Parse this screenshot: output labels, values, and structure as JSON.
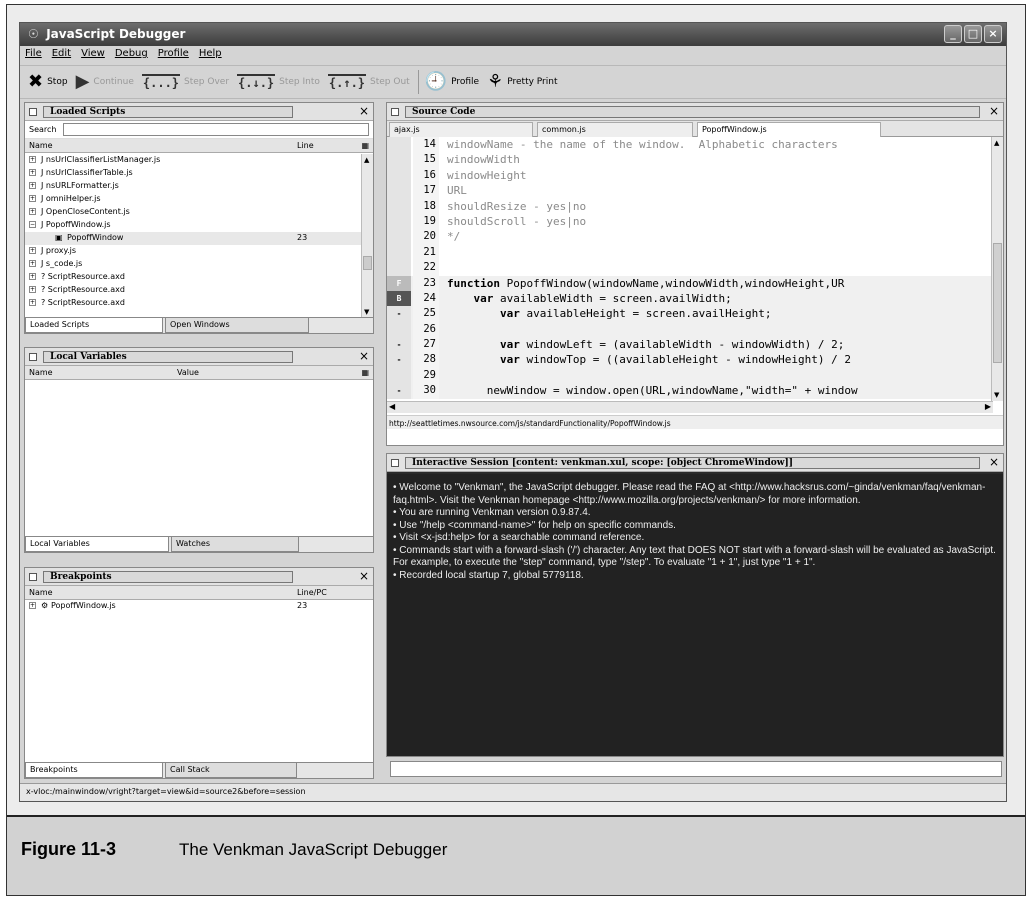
{
  "window": {
    "title": "JavaScript Debugger",
    "controls": [
      "_",
      "□",
      "×"
    ]
  },
  "menu": [
    "File",
    "Edit",
    "View",
    "Debug",
    "Profile",
    "Help"
  ],
  "toolbar": [
    {
      "label": "Stop",
      "icon": "stop-icon",
      "enabled": true
    },
    {
      "label": "Continue",
      "icon": "continue-icon",
      "enabled": false
    },
    {
      "label": "Step Over",
      "icon": "step-over-icon",
      "enabled": false
    },
    {
      "label": "Step Into",
      "icon": "step-into-icon",
      "enabled": false
    },
    {
      "label": "Step Out",
      "icon": "step-out-icon",
      "enabled": false
    },
    {
      "label": "Profile",
      "icon": "profile-icon",
      "enabled": true
    },
    {
      "label": "Pretty Print",
      "icon": "pretty-print-icon",
      "enabled": true
    }
  ],
  "loaded_scripts": {
    "title": "Loaded Scripts",
    "search_label": "Search",
    "columns": [
      "Name",
      "Line"
    ],
    "rows": [
      {
        "toggle": "+",
        "name": "J nsUrlClassifierListManager.js",
        "line": ""
      },
      {
        "toggle": "+",
        "name": "J nsUrlClassifierTable.js",
        "line": ""
      },
      {
        "toggle": "+",
        "name": "J nsURLFormatter.js",
        "line": ""
      },
      {
        "toggle": "+",
        "name": "J omniHelper.js",
        "line": ""
      },
      {
        "toggle": "+",
        "name": "J OpenCloseContent.js",
        "line": ""
      },
      {
        "toggle": "−",
        "name": "J PopoffWindow.js",
        "line": ""
      },
      {
        "toggle": "",
        "name": "PopoffWindow",
        "line": "23",
        "child": true
      },
      {
        "toggle": "+",
        "name": "J proxy.js",
        "line": ""
      },
      {
        "toggle": "+",
        "name": "J s_code.js",
        "line": ""
      },
      {
        "toggle": "+",
        "name": "? ScriptResource.axd",
        "line": ""
      },
      {
        "toggle": "+",
        "name": "? ScriptResource.axd",
        "line": ""
      },
      {
        "toggle": "+",
        "name": "? ScriptResource.axd",
        "line": ""
      }
    ],
    "tabs": [
      "Loaded Scripts",
      "Open Windows"
    ]
  },
  "local_variables": {
    "title": "Local Variables",
    "columns": [
      "Name",
      "Value"
    ],
    "tabs": [
      "Local Variables",
      "Watches"
    ]
  },
  "breakpoints": {
    "title": "Breakpoints",
    "columns": [
      "Name",
      "Line/PC"
    ],
    "rows": [
      {
        "name": "PopoffWindow.js",
        "line": "23"
      }
    ],
    "tabs": [
      "Breakpoints",
      "Call Stack"
    ]
  },
  "source": {
    "title": "Source Code",
    "tabs": [
      "ajax.js",
      "common.js",
      "PopoffWindow.js"
    ],
    "lines": [
      {
        "n": "14",
        "gutter": "",
        "text": "windowName - the name of the window.  Alphabetic characters",
        "comment": true
      },
      {
        "n": "15",
        "gutter": "",
        "text": "windowWidth",
        "comment": true
      },
      {
        "n": "16",
        "gutter": "",
        "text": "windowHeight",
        "comment": true
      },
      {
        "n": "17",
        "gutter": "",
        "text": "URL",
        "comment": true
      },
      {
        "n": "18",
        "gutter": "",
        "text": "shouldResize - yes|no",
        "comment": true
      },
      {
        "n": "19",
        "gutter": "",
        "text": "shouldScroll - yes|no",
        "comment": true
      },
      {
        "n": "20",
        "gutter": "",
        "text": "*/",
        "comment": true
      },
      {
        "n": "21",
        "gutter": "",
        "text": "",
        "comment": false
      },
      {
        "n": "22",
        "gutter": "",
        "text": "",
        "comment": false
      },
      {
        "n": "23",
        "gutter": "F",
        "text": "function PopoffWindow(windowName,windowWidth,windowHeight,UR",
        "comment": false,
        "kw": "function"
      },
      {
        "n": "24",
        "gutter": "B",
        "text": "    var availableWidth = screen.availWidth;",
        "comment": false,
        "kw": "var"
      },
      {
        "n": "25",
        "gutter": "-",
        "text": "        var availableHeight = screen.availHeight;",
        "comment": false,
        "kw": "var"
      },
      {
        "n": "26",
        "gutter": "",
        "text": "",
        "comment": false
      },
      {
        "n": "27",
        "gutter": "-",
        "text": "        var windowLeft = (availableWidth - windowWidth) / 2;",
        "comment": false,
        "kw": "var"
      },
      {
        "n": "28",
        "gutter": "-",
        "text": "        var windowTop = ((availableHeight - windowHeight) / 2",
        "comment": false,
        "kw": "var"
      },
      {
        "n": "29",
        "gutter": "",
        "text": "",
        "comment": false
      },
      {
        "n": "30",
        "gutter": "-",
        "text": "      newWindow = window.open(URL,windowName,\"width=\" + window",
        "comment": false
      }
    ],
    "url": "http://seattletimes.nwsource.com/js/standardFunctionality/PopoffWindow.js"
  },
  "session": {
    "title": "Interactive Session [content: venkman.xul, scope: [object ChromeWindow]]",
    "lines": [
      "• Welcome to \"Venkman\", the JavaScript debugger.  Please read the FAQ at <http://www.hacksrus.com/~ginda/venkman/faq/venkman-faq.html>.  Visit the Venkman homepage <http://www.mozilla.org/projects/venkman/> for more information.",
      "• You are running Venkman version 0.9.87.4.",
      "• Use \"/help <command-name>\" for help on specific commands.",
      "• Visit <x-jsd:help> for a searchable command reference.",
      "• Commands start with a forward-slash ('/') character.  Any text that DOES NOT start with a forward-slash will be evaluated as JavaScript.  For example, to execute the \"step\" command, type \"/step\".  To evaluate \"1 + 1\", just type \"1 + 1\".",
      "• Recorded local startup 7, global 5779118."
    ],
    "input_value": ""
  },
  "status": "x-vloc:/mainwindow/vright?target=view&id=source2&before=session",
  "caption": {
    "figure": "Figure 11-3",
    "text": "The Venkman JavaScript Debugger"
  }
}
